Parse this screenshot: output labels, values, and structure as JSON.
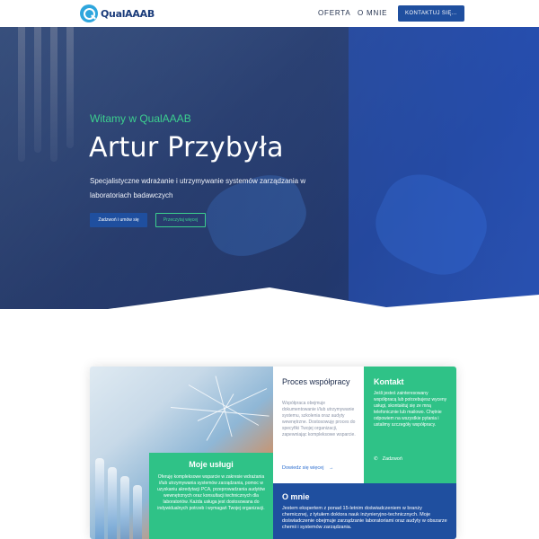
{
  "nav": {
    "logo_text": "QualAAAB",
    "links": [
      "OFERTA",
      "O MNIE"
    ],
    "cta": "KONTAKTUJ SIĘ..."
  },
  "hero": {
    "welcome": "Witamy w QualAAAB",
    "title": "Artur Przybyła",
    "description": "Specjalistyczne wdrażanie i utrzymywanie systemów zarządzania w laboratoriach badawczych",
    "btn_primary": "Zadzwoń i umów się",
    "btn_secondary": "Przeczytaj więcej"
  },
  "cards": {
    "uslugi": {
      "title": "Moje usługi",
      "text": "Oferuję kompleksowe wsparcie w zakresie wdrażania i/lub utrzymywania systemów zarządzania, pomoc w uzyskaniu akredytacji PCA, przeprowadzania audytów wewnętrznych oraz konsultacji technicznych dla laboratoriów. Każda usługa jest dostosowana do indywidualnych potrzeb i wymagań Twojej organizacji."
    },
    "proces": {
      "title": "Proces współpracy",
      "text": "Współpraca obejmuje dokumentowanie i/lub utrzymywanie systemu, szkolenia oraz audyty wewnętrzne. Dostosowuję proces do specyfiki Twojej organizacji, zapewniając kompleksowe wsparcie.",
      "link": "Dowiedz się więcej"
    },
    "kontakt": {
      "title": "Kontakt",
      "text": "Jeśli jesteś zainteresowany współpracą lub potrzebujesz wyceny usługi, skontaktuj się ze mną telefonicznie lub mailowo. Chętnie odpowiem na wszystkie pytania i ustalimy szczegóły współpracy.",
      "call": "Zadzwoń"
    },
    "omnie": {
      "title": "O mnie",
      "text": "Jestem ekspertem z ponad 15-letnim doświadczeniem w branży chemicznej, z tytułem doktora nauk inżynieryjno-technicznych. Moje doświadczenie obejmuje zarządzanie laboratoriami oraz audyty w obszarze chemii i systemów zarządzania."
    }
  },
  "colors": {
    "brand_blue": "#1f4f9f",
    "accent_green": "#2fc287",
    "hero_green": "#3ccf8e"
  }
}
